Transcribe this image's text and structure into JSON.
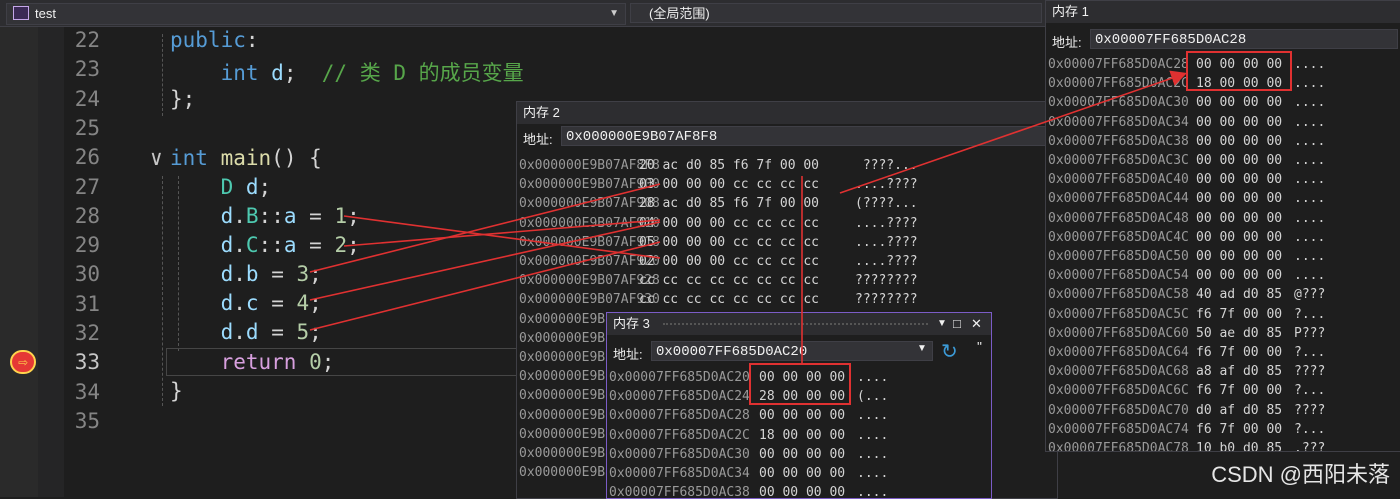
{
  "toolbar": {
    "file": "test",
    "scope": "(全局范围)"
  },
  "editor": {
    "line_numbers": [
      "22",
      "23",
      "24",
      "25",
      "26",
      "27",
      "28",
      "29",
      "30",
      "31",
      "32",
      "33",
      "34",
      "35"
    ],
    "current_line": "33"
  },
  "mem1": {
    "title": "内存 1",
    "address_label": "地址:",
    "address": "0x00007FF685D0AC28",
    "rows": [
      {
        "addr": "0x00007FF685D0AC28",
        "bytes": "00 00 00 00",
        "chars": "...."
      },
      {
        "addr": "0x00007FF685D0AC2C",
        "bytes": "18 00 00 00",
        "chars": "...."
      },
      {
        "addr": "0x00007FF685D0AC30",
        "bytes": "00 00 00 00",
        "chars": "...."
      },
      {
        "addr": "0x00007FF685D0AC34",
        "bytes": "00 00 00 00",
        "chars": "...."
      },
      {
        "addr": "0x00007FF685D0AC38",
        "bytes": "00 00 00 00",
        "chars": "...."
      },
      {
        "addr": "0x00007FF685D0AC3C",
        "bytes": "00 00 00 00",
        "chars": "...."
      },
      {
        "addr": "0x00007FF685D0AC40",
        "bytes": "00 00 00 00",
        "chars": "...."
      },
      {
        "addr": "0x00007FF685D0AC44",
        "bytes": "00 00 00 00",
        "chars": "...."
      },
      {
        "addr": "0x00007FF685D0AC48",
        "bytes": "00 00 00 00",
        "chars": "...."
      },
      {
        "addr": "0x00007FF685D0AC4C",
        "bytes": "00 00 00 00",
        "chars": "...."
      },
      {
        "addr": "0x00007FF685D0AC50",
        "bytes": "00 00 00 00",
        "chars": "...."
      },
      {
        "addr": "0x00007FF685D0AC54",
        "bytes": "00 00 00 00",
        "chars": "...."
      },
      {
        "addr": "0x00007FF685D0AC58",
        "bytes": "40 ad d0 85",
        "chars": "@???"
      },
      {
        "addr": "0x00007FF685D0AC5C",
        "bytes": "f6 7f 00 00",
        "chars": "?..."
      },
      {
        "addr": "0x00007FF685D0AC60",
        "bytes": "50 ae d0 85",
        "chars": "P???"
      },
      {
        "addr": "0x00007FF685D0AC64",
        "bytes": "f6 7f 00 00",
        "chars": "?..."
      },
      {
        "addr": "0x00007FF685D0AC68",
        "bytes": "a8 af d0 85",
        "chars": "????"
      },
      {
        "addr": "0x00007FF685D0AC6C",
        "bytes": "f6 7f 00 00",
        "chars": "?..."
      },
      {
        "addr": "0x00007FF685D0AC70",
        "bytes": "d0 af d0 85",
        "chars": "????"
      },
      {
        "addr": "0x00007FF685D0AC74",
        "bytes": "f6 7f 00 00",
        "chars": "?..."
      },
      {
        "addr": "0x00007FF685D0AC78",
        "bytes": "10 b0 d0 85",
        "chars": ".???"
      }
    ]
  },
  "mem2": {
    "title": "内存 2",
    "address_label": "地址:",
    "address": "0x000000E9B07AF8F8",
    "rows": [
      {
        "addr": "0x000000E9B07AF8F8",
        "bytes": "20 ac d0 85 f6 7f 00 00",
        "chars": " ????..."
      },
      {
        "addr": "0x000000E9B07AF900",
        "bytes": "03 00 00 00 cc cc cc cc",
        "chars": "....????"
      },
      {
        "addr": "0x000000E9B07AF908",
        "bytes": "28 ac d0 85 f6 7f 00 00",
        "chars": "(????..."
      },
      {
        "addr": "0x000000E9B07AF910",
        "bytes": "04 00 00 00 cc cc cc cc",
        "chars": "....????"
      },
      {
        "addr": "0x000000E9B07AF918",
        "bytes": "05 00 00 00 cc cc cc cc",
        "chars": "....????"
      },
      {
        "addr": "0x000000E9B07AF920",
        "bytes": "02 00 00 00 cc cc cc cc",
        "chars": "....????"
      },
      {
        "addr": "0x000000E9B07AF928",
        "bytes": "cc cc cc cc cc cc cc cc",
        "chars": "????????"
      },
      {
        "addr": "0x000000E9B07AF930",
        "bytes": "cc cc cc cc cc cc cc cc",
        "chars": "????????"
      },
      {
        "addr": "0x000000E9B0",
        "bytes": "",
        "chars": ""
      },
      {
        "addr": "0x000000E9B0",
        "bytes": "",
        "chars": ""
      },
      {
        "addr": "0x000000E9B0",
        "bytes": "",
        "chars": ""
      },
      {
        "addr": "0x000000E9B0",
        "bytes": "",
        "chars": ""
      },
      {
        "addr": "0x000000E9B0",
        "bytes": "",
        "chars": ""
      },
      {
        "addr": "0x000000E9B0",
        "bytes": "",
        "chars": ""
      },
      {
        "addr": "0x000000E9B0",
        "bytes": "",
        "chars": ""
      },
      {
        "addr": "0x000000E9B0",
        "bytes": "",
        "chars": ""
      },
      {
        "addr": "0x000000E9B0",
        "bytes": "",
        "chars": ""
      }
    ]
  },
  "mem3": {
    "title": "内存 3",
    "address_label": "地址:",
    "address": "0x00007FF685D0AC20",
    "rows": [
      {
        "addr": "0x00007FF685D0AC20",
        "bytes": "00 00 00 00",
        "chars": "...."
      },
      {
        "addr": "0x00007FF685D0AC24",
        "bytes": "28 00 00 00",
        "chars": "(..."
      },
      {
        "addr": "0x00007FF685D0AC28",
        "bytes": "00 00 00 00",
        "chars": "...."
      },
      {
        "addr": "0x00007FF685D0AC2C",
        "bytes": "18 00 00 00",
        "chars": "...."
      },
      {
        "addr": "0x00007FF685D0AC30",
        "bytes": "00 00 00 00",
        "chars": "...."
      },
      {
        "addr": "0x00007FF685D0AC34",
        "bytes": "00 00 00 00",
        "chars": "...."
      },
      {
        "addr": "0x00007FF685D0AC38",
        "bytes": "00 00 00 00",
        "chars": "...."
      }
    ]
  },
  "watermark": "CSDN @西阳未落",
  "annotation_color": "#e03131"
}
